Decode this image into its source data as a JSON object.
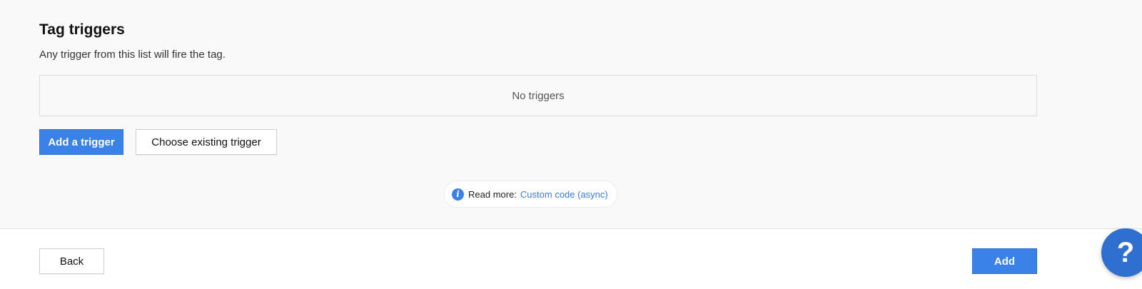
{
  "section": {
    "title": "Tag triggers",
    "subtitle": "Any trigger from this list will fire the tag.",
    "empty_text": "No triggers"
  },
  "actions": {
    "add_trigger_label": "Add a trigger",
    "choose_existing_label": "Choose existing trigger"
  },
  "read_more": {
    "icon": "info-icon",
    "label": "Read more:",
    "link_text": "Custom code (async)"
  },
  "footer": {
    "back_label": "Back",
    "add_label": "Add"
  },
  "help": {
    "icon": "question-icon",
    "glyph": "?"
  },
  "colors": {
    "primary": "#3b82e8",
    "link": "#3b7dd8",
    "help": "#2f6fd0"
  }
}
